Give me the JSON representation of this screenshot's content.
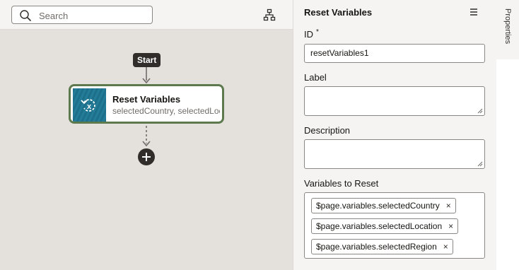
{
  "canvas": {
    "search": {
      "placeholder": "Search",
      "icon": "search-icon"
    },
    "toolbar_icon": "diagram-layout-icon",
    "start_label": "Start",
    "action": {
      "title": "Reset Variables",
      "subtitle": "selectedCountry, selectedLocation, selectedRegion",
      "icon": "reset-variable-icon"
    },
    "add_icon": "plus-icon"
  },
  "panel": {
    "title": "Reset Variables",
    "menu_icon": "hamburger-menu-icon",
    "id_label": "ID",
    "id_required": "*",
    "id_value": "resetVariables1",
    "label_label": "Label",
    "label_value": "",
    "description_label": "Description",
    "description_value": "",
    "variables_label": "Variables to Reset",
    "variables": [
      "$page.variables.selectedCountry",
      "$page.variables.selectedLocation",
      "$page.variables.selectedRegion"
    ],
    "remove_glyph": "×"
  },
  "side_tab": {
    "label": "Properties"
  },
  "colors": {
    "canvas_bg": "#e4e1dc",
    "panel_bg": "#f5f4f2",
    "card_border": "#5d7a4f",
    "action_tile": "#1d6f8a",
    "dark": "#312d2a"
  }
}
